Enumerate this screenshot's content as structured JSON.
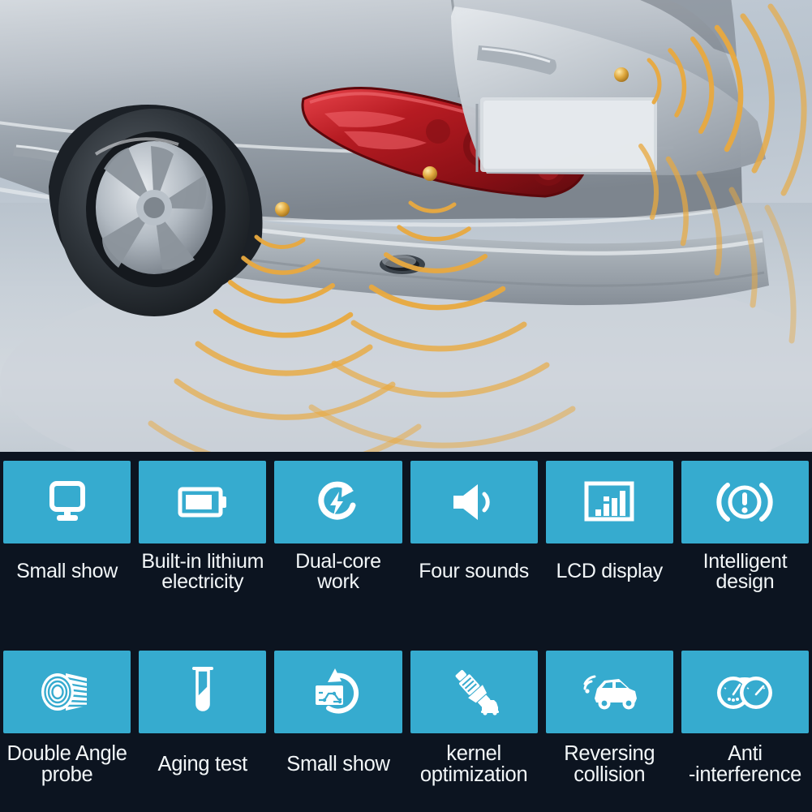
{
  "hero": {
    "alt_description": "Rear of silver hatchback car with amber parking sensor waves radiating from bumper sensors",
    "vehicle_color": "#b9c0c7",
    "taillight_color": "#a8141a",
    "sensor_wave_color": "#e8a33d",
    "sensor_dot_color": "#d8a23c",
    "ground_color": "#c7cfd7"
  },
  "theme": {
    "tile_color": "#36abcf",
    "background_color": "#0c1420",
    "icon_color": "#ffffff",
    "label_color": "#f2f6f8"
  },
  "features": {
    "row1": [
      {
        "icon": "monitor-display-icon",
        "label": "Small show"
      },
      {
        "icon": "battery-icon",
        "label": "Built-in lithium\nelectricity"
      },
      {
        "icon": "refresh-lightning-icon",
        "label": "Dual-core\nwork"
      },
      {
        "icon": "speaker-volume-icon",
        "label": "Four sounds"
      },
      {
        "icon": "lcd-bar-chart-icon",
        "label": "LCD display"
      },
      {
        "icon": "brake-warning-icon",
        "label": "Intelligent design"
      }
    ],
    "row2": [
      {
        "icon": "sensor-probe-icon",
        "label": "Double Angle\nprobe"
      },
      {
        "icon": "test-tube-icon",
        "label": "Aging test"
      },
      {
        "icon": "circuit-refresh-icon",
        "label": "Small show"
      },
      {
        "icon": "spark-plug-car-icon",
        "label": "kernel\noptimization"
      },
      {
        "icon": "car-signal-icon",
        "label": "Reversing\ncollision"
      },
      {
        "icon": "dual-gauge-icon",
        "label": "Anti\n-interference"
      }
    ]
  }
}
